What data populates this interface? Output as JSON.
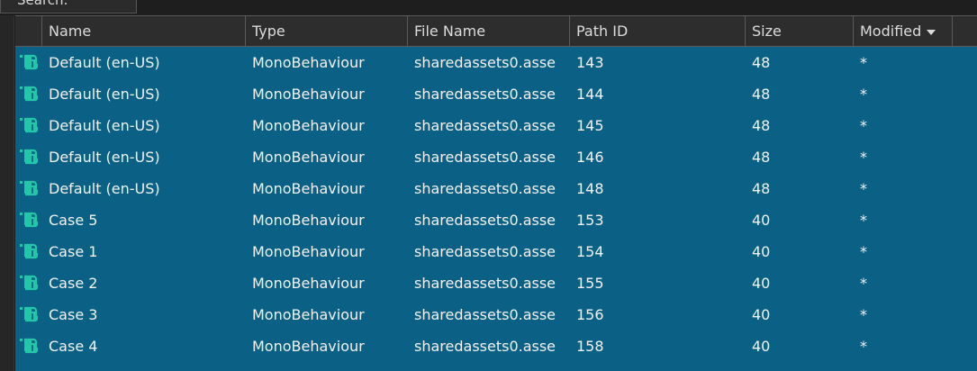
{
  "search_tab": {
    "label": "Search:"
  },
  "header": {
    "name": "Name",
    "type": "Type",
    "file_name": "File Name",
    "path_id": "Path ID",
    "size": "Size",
    "modified": "Modified"
  },
  "rows": [
    {
      "name": "Default (en-US)",
      "type": "MonoBehaviour",
      "file": "sharedassets0.asse",
      "path_id": "143",
      "size": "48",
      "modified": "*"
    },
    {
      "name": "Default (en-US)",
      "type": "MonoBehaviour",
      "file": "sharedassets0.asse",
      "path_id": "144",
      "size": "48",
      "modified": "*"
    },
    {
      "name": "Default (en-US)",
      "type": "MonoBehaviour",
      "file": "sharedassets0.asse",
      "path_id": "145",
      "size": "48",
      "modified": "*"
    },
    {
      "name": "Default (en-US)",
      "type": "MonoBehaviour",
      "file": "sharedassets0.asse",
      "path_id": "146",
      "size": "48",
      "modified": "*"
    },
    {
      "name": "Default (en-US)",
      "type": "MonoBehaviour",
      "file": "sharedassets0.asse",
      "path_id": "148",
      "size": "48",
      "modified": "*"
    },
    {
      "name": "Case 5",
      "type": "MonoBehaviour",
      "file": "sharedassets0.asse",
      "path_id": "153",
      "size": "40",
      "modified": "*"
    },
    {
      "name": "Case 1",
      "type": "MonoBehaviour",
      "file": "sharedassets0.asse",
      "path_id": "154",
      "size": "40",
      "modified": "*"
    },
    {
      "name": "Case 2",
      "type": "MonoBehaviour",
      "file": "sharedassets0.asse",
      "path_id": "155",
      "size": "40",
      "modified": "*"
    },
    {
      "name": "Case 3",
      "type": "MonoBehaviour",
      "file": "sharedassets0.asse",
      "path_id": "156",
      "size": "40",
      "modified": "*"
    },
    {
      "name": "Case 4",
      "type": "MonoBehaviour",
      "file": "sharedassets0.asse",
      "path_id": "158",
      "size": "40",
      "modified": "*"
    }
  ],
  "icon": "script-icon",
  "colors": {
    "selection": "#0b6185",
    "icon": "#22c7a9",
    "header_bg": "#2d2d2d"
  }
}
